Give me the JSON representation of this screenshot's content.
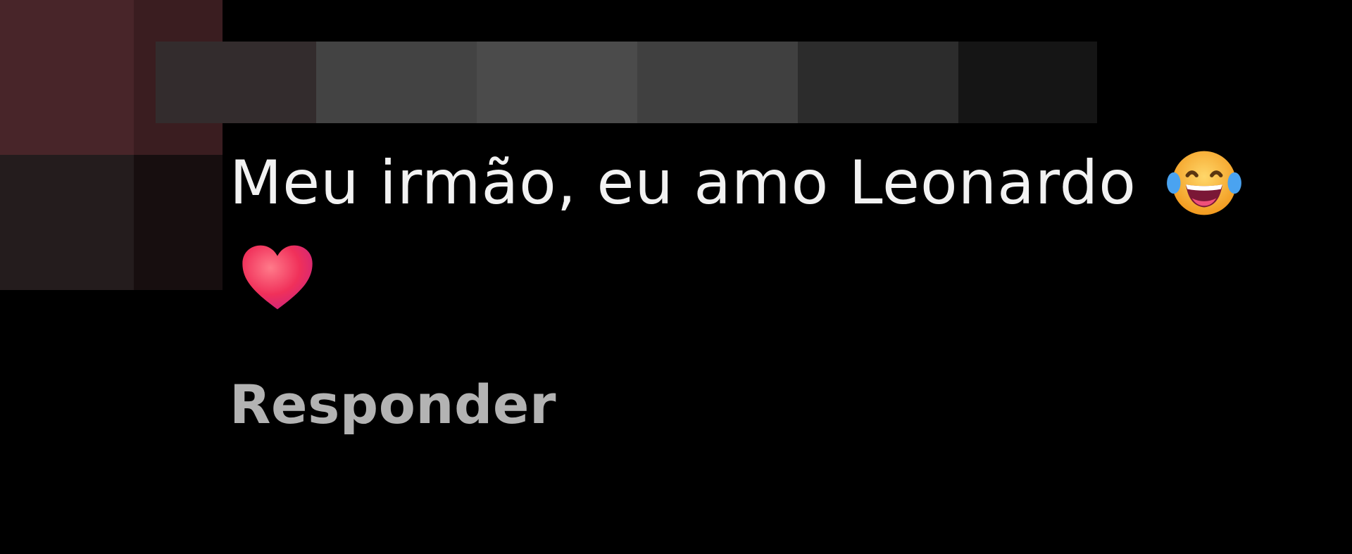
{
  "comment": {
    "text": "Meu irmão, eu amo Leonardo",
    "emojis": [
      "laughing-with-tears-emoji",
      "red-heart-emoji"
    ]
  },
  "actions": {
    "reply_label": "Responder"
  },
  "colors": {
    "background": "#000000",
    "comment_text": "#f2f2f2",
    "reply_text": "#b3b3b3",
    "heart": "#f0305a",
    "laugh_face": "#f7b733"
  },
  "censored": {
    "avatar_pixels": [
      "#482529",
      "#3a1d20",
      "#241c1d",
      "#170e0f"
    ],
    "username_pixels": [
      "#332c2d",
      "#434343",
      "#4b4b4b",
      "#404040",
      "#2c2c2c",
      "#151515"
    ]
  }
}
